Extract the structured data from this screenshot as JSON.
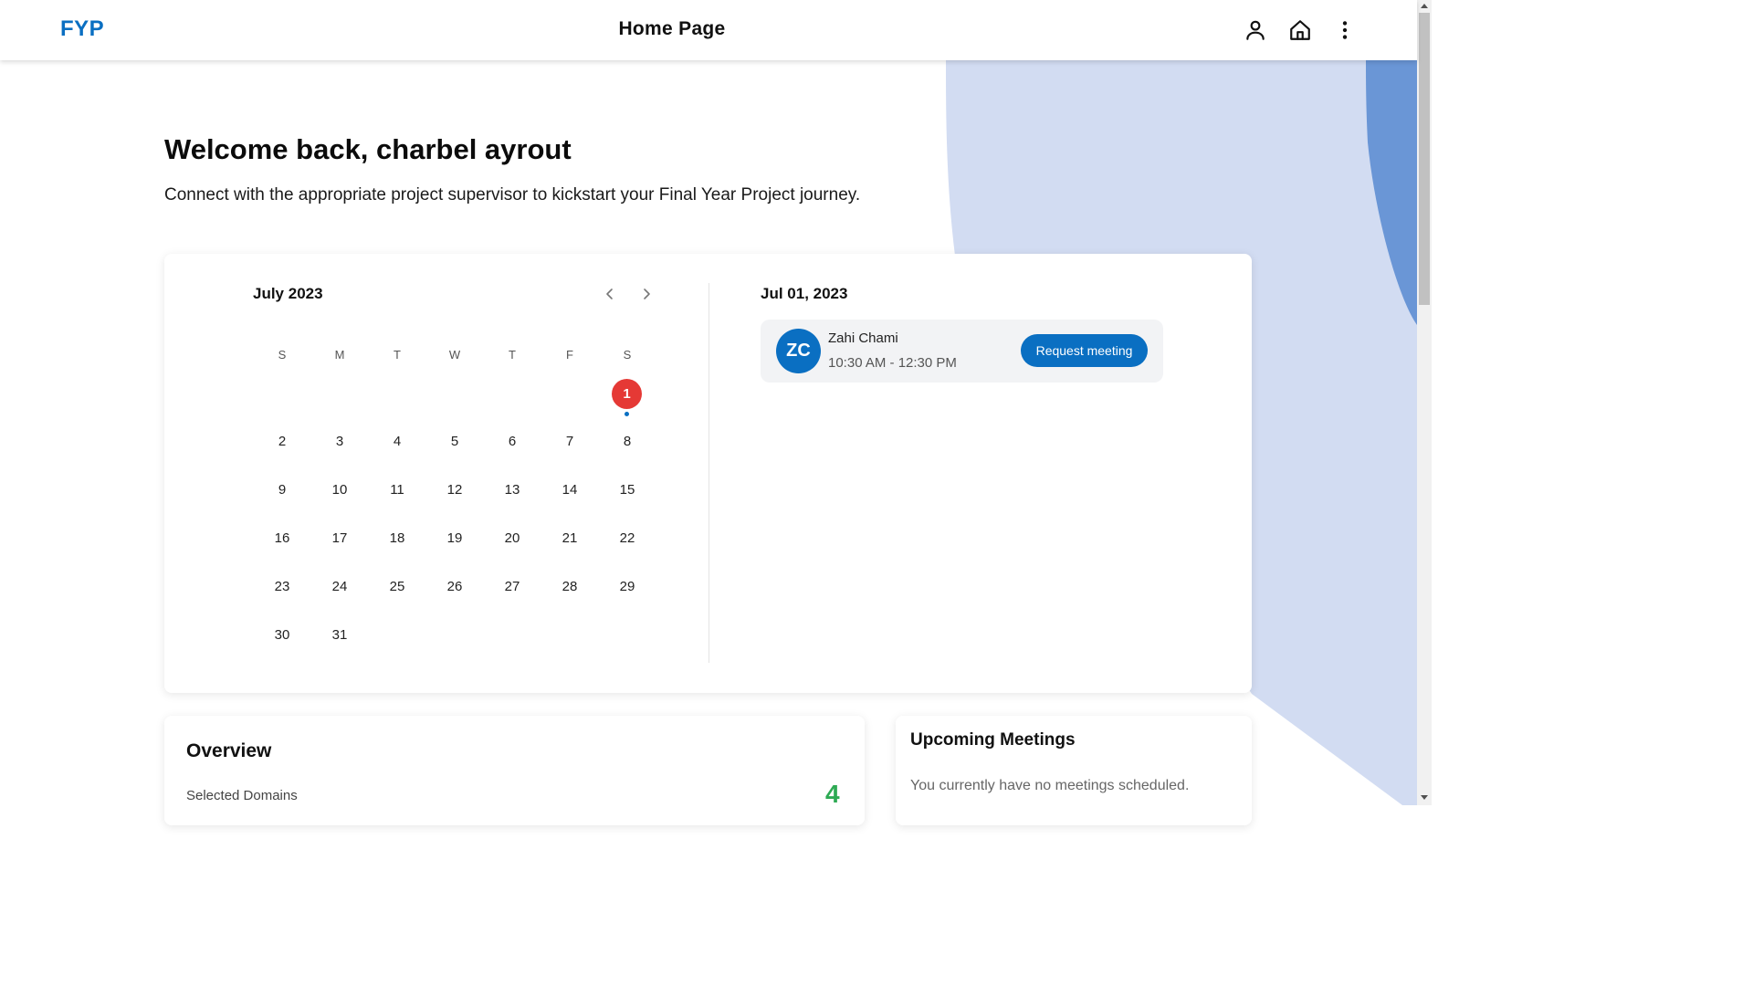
{
  "header": {
    "brand": "FYP",
    "title": "Home Page",
    "icons": [
      "user-icon",
      "home-icon",
      "more-vertical-icon"
    ]
  },
  "welcome": {
    "title": "Welcome back, charbel ayrout",
    "subtitle": "Connect with the appropriate project supervisor to kickstart your Final Year Project journey."
  },
  "calendar": {
    "month_label": "July 2023",
    "weekdays": [
      "S",
      "M",
      "T",
      "W",
      "T",
      "F",
      "S"
    ],
    "days": [
      "1",
      "2",
      "3",
      "4",
      "5",
      "6",
      "7",
      "8",
      "9",
      "10",
      "11",
      "12",
      "13",
      "14",
      "15",
      "16",
      "17",
      "18",
      "19",
      "20",
      "21",
      "22",
      "23",
      "24",
      "25",
      "26",
      "27",
      "28",
      "29",
      "30",
      "31"
    ],
    "selected_day": "1",
    "colors": {
      "selected": "#e53935",
      "accent": "#0a6fc2"
    }
  },
  "availability": {
    "date_label": "Jul 01, 2023",
    "slots": [
      {
        "initials": "ZC",
        "name": "Zahi Chami",
        "time": "10:30 AM - 12:30 PM",
        "action": "Request meeting"
      }
    ]
  },
  "overview": {
    "title": "Overview",
    "stats": [
      {
        "label": "Selected Domains",
        "value": "4"
      }
    ]
  },
  "upcoming": {
    "title": "Upcoming Meetings",
    "empty_text": "You currently have no meetings scheduled."
  }
}
